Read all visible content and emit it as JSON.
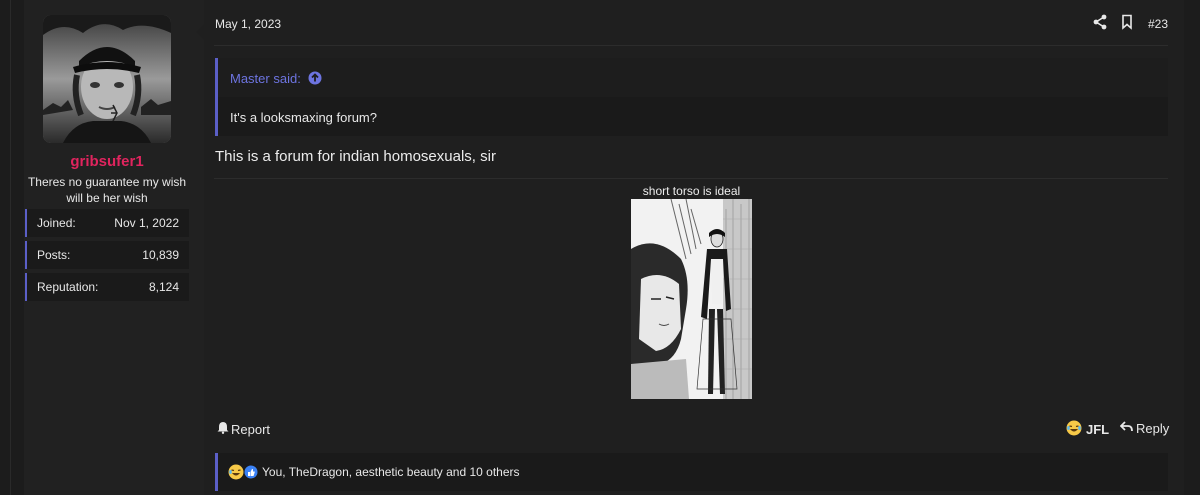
{
  "post": {
    "date": "May 1, 2023",
    "number": "#23",
    "message": "This is a forum for indian homosexuals, sir",
    "image_caption": "short torso is ideal"
  },
  "user": {
    "name": "gribsufer1",
    "title": "Theres no guarantee my wish will be her wish",
    "stats": [
      {
        "label": "Joined:",
        "value": "Nov 1, 2022"
      },
      {
        "label": "Posts:",
        "value": "10,839"
      },
      {
        "label": "Reputation:",
        "value": "8,124"
      }
    ]
  },
  "quote": {
    "attribution": "Master said:",
    "text": "It's a looksmaxing forum?"
  },
  "actions": {
    "report": "Report",
    "jfl": "JFL",
    "reply": "Reply"
  },
  "reactions": {
    "text": "You, TheDragon, aesthetic beauty and 10 others"
  },
  "colors": {
    "accent": "#5b5fc7",
    "username": "#e0245e",
    "quote_attr": "#6d74e0"
  },
  "icons": [
    "share-icon",
    "bookmark-icon",
    "arrow-up-circle-icon",
    "bell-icon",
    "laughing-emoji-icon",
    "reply-arrow-icon",
    "like-icon"
  ]
}
